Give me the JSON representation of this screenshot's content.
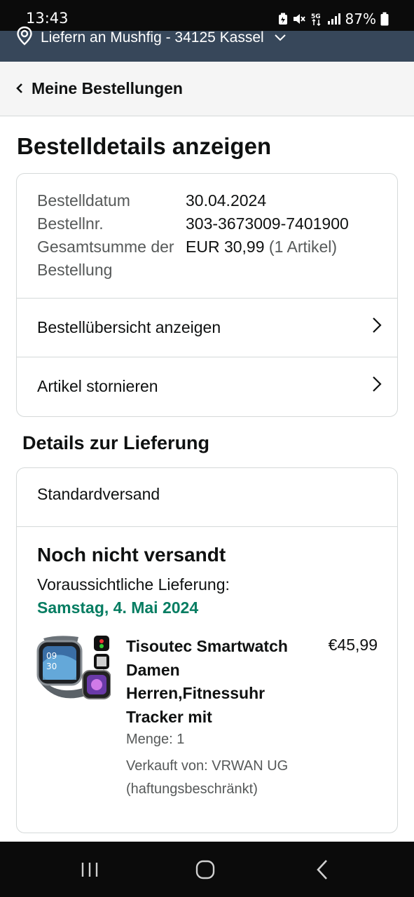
{
  "status_bar": {
    "time": "13:43",
    "network": "5G",
    "battery": "87%",
    "icons": [
      "battery-saver-icon",
      "mute-icon",
      "5g-icon",
      "signal-icon",
      "battery-icon"
    ]
  },
  "deliver_bar": {
    "label": "Liefern an Mushfig - 34125 Kassel",
    "icon": "location-pin-icon"
  },
  "back_nav": {
    "label": "Meine Bestellungen"
  },
  "page": {
    "title": "Bestelldetails anzeigen"
  },
  "order_summary": {
    "date_label": "Bestelldatum",
    "date_value": "30.04.2024",
    "number_label": "Bestellnr.",
    "number_value": "303-3673009-7401900",
    "total_label": "Gesamtsumme der Bestellung",
    "total_value": "EUR 30,99",
    "total_items": "(1 Artikel)"
  },
  "actions": {
    "view_summary": "Bestellübersicht anzeigen",
    "cancel_items": "Artikel stornieren"
  },
  "delivery": {
    "section_title": "Details zur Lieferung",
    "method": "Standardversand",
    "status": "Noch nicht versandt",
    "eta_label": "Voraussichtliche Lieferung:",
    "eta_date": "Samstag, 4. Mai 2024"
  },
  "item": {
    "title": "Tisoutec Smartwatch Damen Herren,Fitnessuhr Tracker mit",
    "price": "€45,99",
    "quantity": "Menge: 1",
    "seller": "Verkauft von: VRWAN UG (haftungsbeschränkt)"
  },
  "colors": {
    "deliver_bar_bg": "#37475a",
    "eta_green": "#067d62",
    "text": "#0f1111",
    "muted_text": "#565959"
  }
}
